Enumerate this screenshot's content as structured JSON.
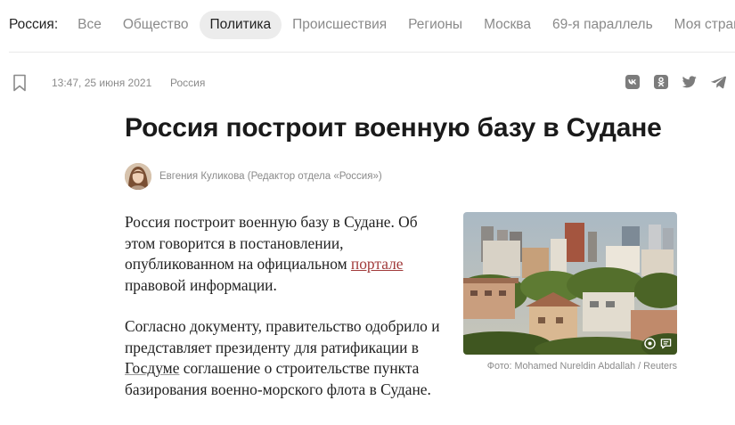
{
  "nav": {
    "section_label": "Россия:",
    "items": [
      {
        "label": "Все",
        "active": false
      },
      {
        "label": "Общество",
        "active": false
      },
      {
        "label": "Политика",
        "active": true
      },
      {
        "label": "Происшествия",
        "active": false
      },
      {
        "label": "Регионы",
        "active": false
      },
      {
        "label": "Москва",
        "active": false
      },
      {
        "label": "69-я параллель",
        "active": false
      },
      {
        "label": "Моя страна",
        "active": false
      }
    ]
  },
  "meta": {
    "timestamp": "13:47, 25 июня 2021",
    "rubric": "Россия",
    "share_icons": [
      "vk-icon",
      "odnoklassniki-icon",
      "twitter-icon",
      "telegram-icon"
    ]
  },
  "article": {
    "title": "Россия построит военную базу в Судане",
    "author": "Евгения Куликова (Редактор отдела «Россия»)",
    "p1_before": "Россия построит военную базу в Судане. Об этом говорится в постановлении, опубликованном на официальном ",
    "p1_link": "портале",
    "p1_after": " правовой информации.",
    "p2_before": "Согласно документу, правительство одобрило и представляет президенту для ратификации в ",
    "p2_link": "Госдуме",
    "p2_after": " соглашение о строительстве пункта базирования военно-морского флота в Судане."
  },
  "photo": {
    "caption": "Фото: Mohamed Nureldin Abdallah / Reuters"
  },
  "colors": {
    "accent_link": "#a13a3a",
    "active_tab_bg": "#ececec",
    "muted_text": "#8a8a8a"
  }
}
